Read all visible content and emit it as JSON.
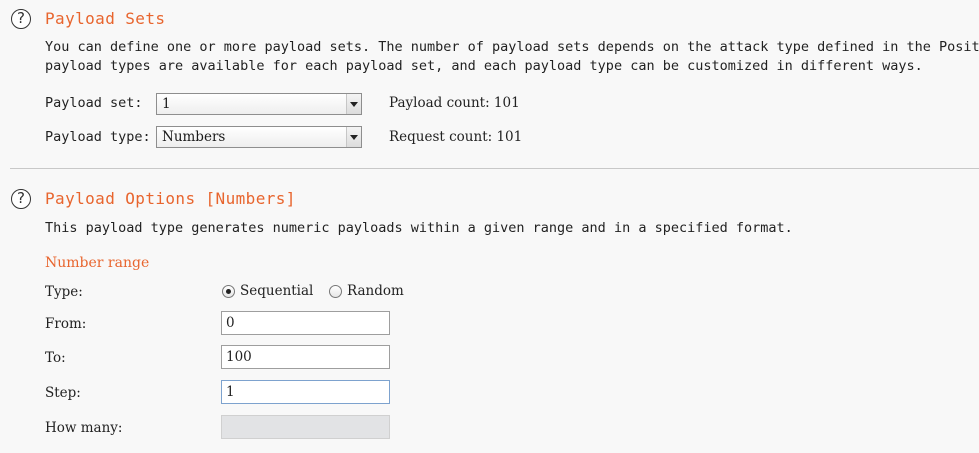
{
  "payload_sets": {
    "title": "Payload Sets",
    "desc_line1": "You can define one or more payload sets. The number of payload sets depends on the attack type defined in the Positic",
    "desc_line2": "payload types are available for each payload set, and each payload type can be customized in different ways.",
    "set_label": "Payload set:",
    "set_value": "1",
    "type_label": "Payload type:",
    "type_value": "Numbers",
    "payload_count": "Payload count: 101",
    "request_count": "Request count: 101"
  },
  "payload_options": {
    "title": "Payload Options [Numbers]",
    "desc": "This payload type generates numeric payloads within a given range and in a specified format.",
    "number_range_heading": "Number range",
    "type_label": "Type:",
    "type_options": [
      "Sequential",
      "Random"
    ],
    "type_selected": "Sequential",
    "from_label": "From:",
    "from_value": "0",
    "to_label": "To:",
    "to_value": "100",
    "step_label": "Step:",
    "step_value": "1",
    "how_many_label": "How many:",
    "how_many_value": ""
  },
  "colors": {
    "accent": "#e8652e"
  },
  "icons": {
    "help": "help-icon"
  }
}
